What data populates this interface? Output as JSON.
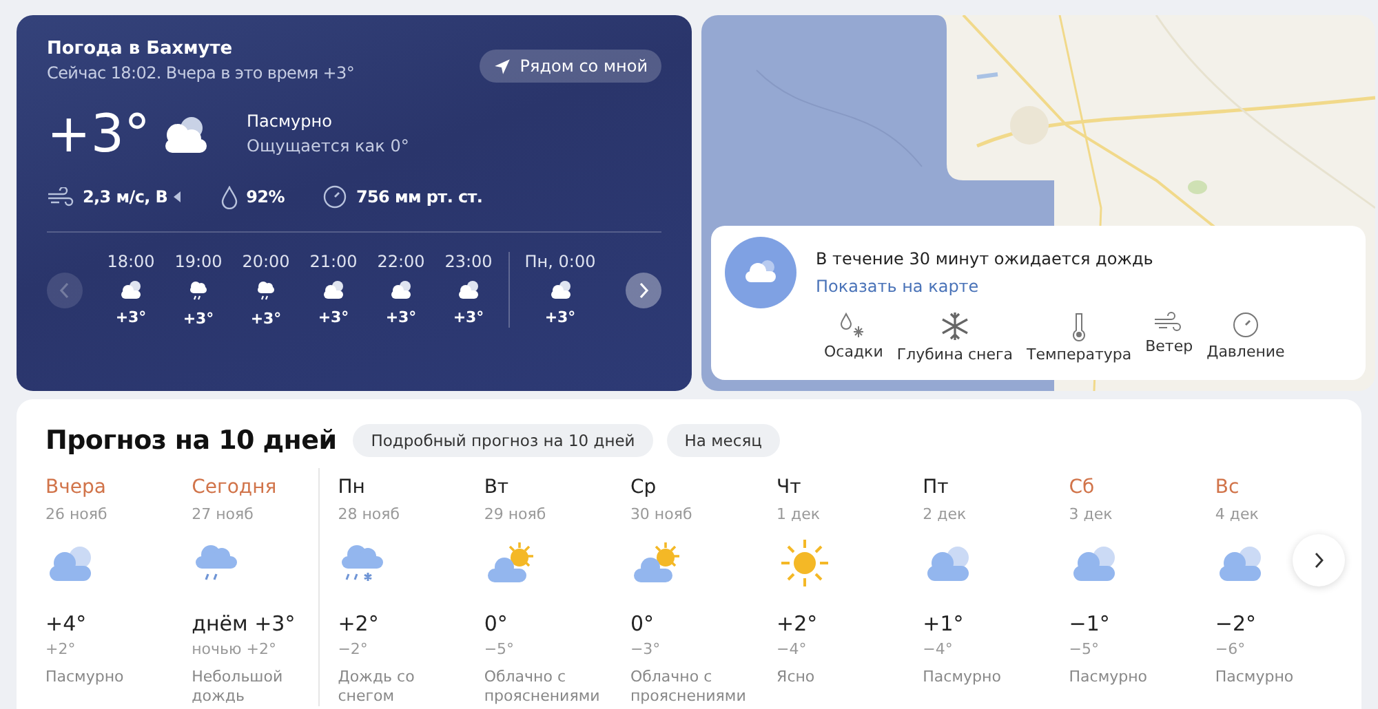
{
  "current": {
    "title": "Погода в Бахмуте",
    "subtitle": "Сейчас 18:02. Вчера в это время +3°",
    "nearby_button": "Рядом со мной",
    "temperature": "+3°",
    "kind": "cloudy",
    "condition": "Пасмурно",
    "feels_like": "Ощущается как 0°",
    "wind": "2,3 м/с, В",
    "humidity": "92%",
    "pressure": "756 мм рт. ст."
  },
  "hourly_nav": {
    "prev_disabled": true,
    "next_disabled": false
  },
  "hourly": [
    {
      "time": "18:00",
      "kind": "cloudy-night",
      "temp": "+3°",
      "divider_before": false
    },
    {
      "time": "19:00",
      "kind": "rain",
      "temp": "+3°",
      "divider_before": false
    },
    {
      "time": "20:00",
      "kind": "rain",
      "temp": "+3°",
      "divider_before": false
    },
    {
      "time": "21:00",
      "kind": "cloudy-night",
      "temp": "+3°",
      "divider_before": false
    },
    {
      "time": "22:00",
      "kind": "cloudy-night",
      "temp": "+3°",
      "divider_before": false
    },
    {
      "time": "23:00",
      "kind": "cloudy-night",
      "temp": "+3°",
      "divider_before": false
    },
    {
      "time": "Пн, 0:00",
      "kind": "cloudy-night",
      "temp": "+3°",
      "divider_before": true
    }
  ],
  "map": {
    "kind": "picture",
    "alert": "В течение 30 минут ожидается дождь",
    "alert_link": "Показать на карте",
    "layers": [
      {
        "kind": "precipitation",
        "label": "Осадки"
      },
      {
        "kind": "snow",
        "label": "Глубина снега"
      },
      {
        "kind": "temperature",
        "label": "Температура"
      },
      {
        "kind": "wind",
        "label": "Ветер"
      },
      {
        "kind": "pressure",
        "label": "Давление"
      }
    ]
  },
  "forecast": {
    "title": "Прогноз на 10 дней",
    "buttons": [
      "Подробный прогноз на 10 дней",
      "На месяц"
    ],
    "days": [
      {
        "name": "Вчера",
        "date": "26 нояб",
        "accent": true,
        "divider_before": false,
        "kind": "cloudy",
        "temp": "+4°",
        "night": "+2°",
        "description": "Пасмурно"
      },
      {
        "name": "Сегодня",
        "date": "27 нояб",
        "accent": true,
        "divider_before": false,
        "kind": "rain",
        "temp": "днём +3°",
        "night": "ночью +2°",
        "description": "Небольшой дождь"
      },
      {
        "name": "Пн",
        "date": "28 нояб",
        "accent": false,
        "divider_before": true,
        "kind": "rain-snow",
        "temp": "+2°",
        "night": "−2°",
        "description": "Дождь со снегом"
      },
      {
        "name": "Вт",
        "date": "29 нояб",
        "accent": false,
        "divider_before": false,
        "kind": "partly-sunny",
        "temp": "0°",
        "night": "−5°",
        "description": "Облачно с прояснениями"
      },
      {
        "name": "Ср",
        "date": "30 нояб",
        "accent": false,
        "divider_before": false,
        "kind": "partly-sunny",
        "temp": "0°",
        "night": "−3°",
        "description": "Облачно с прояснениями"
      },
      {
        "name": "Чт",
        "date": "1 дек",
        "accent": false,
        "divider_before": false,
        "kind": "sunny",
        "temp": "+2°",
        "night": "−4°",
        "description": "Ясно"
      },
      {
        "name": "Пт",
        "date": "2 дек",
        "accent": false,
        "divider_before": false,
        "kind": "cloudy",
        "temp": "+1°",
        "night": "−4°",
        "description": "Пасмурно"
      },
      {
        "name": "Сб",
        "date": "3 дек",
        "accent": true,
        "divider_before": false,
        "kind": "cloudy",
        "temp": "−1°",
        "night": "−5°",
        "description": "Пасмурно"
      },
      {
        "name": "Вс",
        "date": "4 дек",
        "accent": true,
        "divider_before": false,
        "kind": "cloudy",
        "temp": "−2°",
        "night": "−6°",
        "description": "Пасмурно"
      }
    ]
  }
}
